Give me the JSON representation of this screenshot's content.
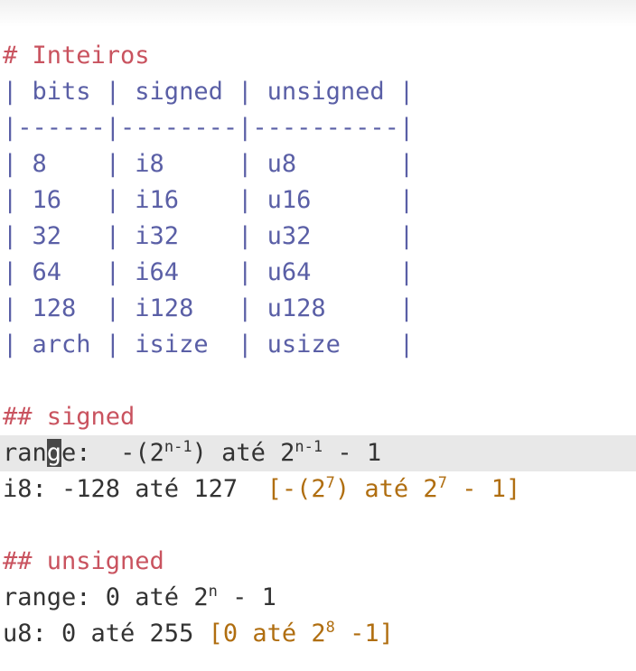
{
  "title": "# Inteiros",
  "table": {
    "header": "| bits | signed | unsigned |",
    "separator": "|------|--------|----------|",
    "rows": [
      "| 8    | i8     | u8       |",
      "| 16   | i16    | u16      |",
      "| 32   | i32    | u32      |",
      "| 64   | i64    | u64      |",
      "| 128  | i128   | u128     |",
      "| arch | isize  | usize    |"
    ]
  },
  "signed": {
    "heading": "## signed",
    "range_pre": "ran",
    "range_cursor_char": "g",
    "range_post": "e:  -(2",
    "range_exp1": "n-1",
    "range_mid": ") até 2",
    "range_exp2": "n-1",
    "range_end": " - 1",
    "example_text": "i8: -128 até 127  ",
    "example_ann_a": "[-(2",
    "example_exp1": "7",
    "example_ann_b": ") até 2",
    "example_exp2": "7",
    "example_ann_c": " - 1]"
  },
  "unsigned": {
    "heading": "## unsigned",
    "range_pre": "range: 0 até 2",
    "range_exp": "n",
    "range_end": " - 1",
    "example_text": "u8: 0 até 255 ",
    "example_ann_a": "[0 até 2",
    "example_exp": "8",
    "example_ann_b": " -1]"
  },
  "colors": {
    "heading": "#c9535f",
    "table": "#5a5fa6",
    "text": "#333333",
    "annotation": "#b06e10",
    "current_line": "#e8e8e8"
  }
}
